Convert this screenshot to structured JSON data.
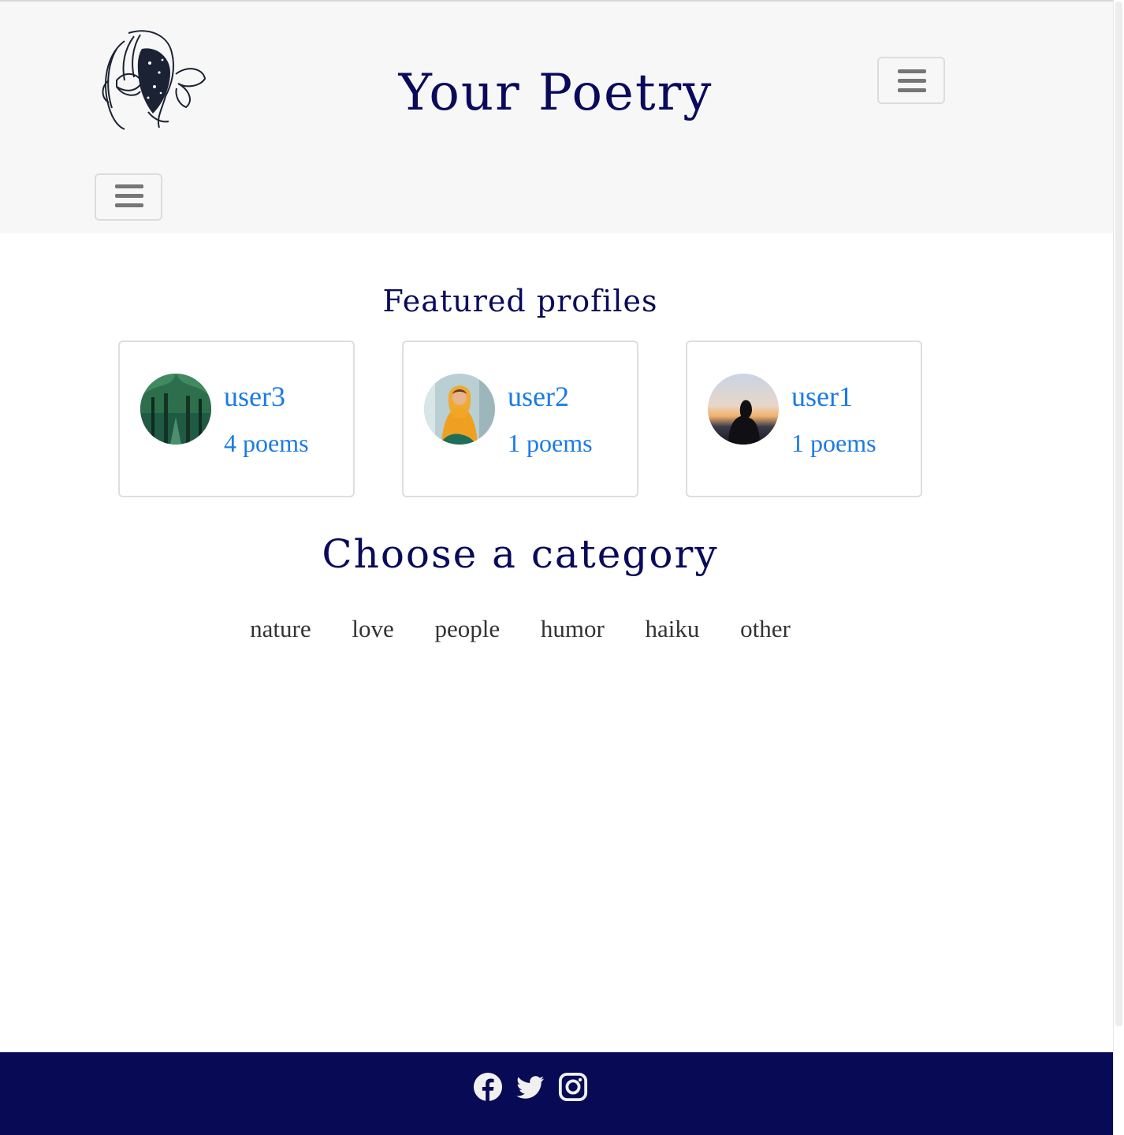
{
  "header": {
    "site_title": "Your Poetry",
    "logo_icon": "woman-butterfly-logo-icon",
    "menu_icon": "hamburger-menu-icon"
  },
  "featured": {
    "title": "Featured profiles",
    "profiles": [
      {
        "username": "user3",
        "poems": "4 poems",
        "avatar": "forest-trees-avatar"
      },
      {
        "username": "user2",
        "poems": "1 poems",
        "avatar": "girl-yellow-hoodie-avatar"
      },
      {
        "username": "user1",
        "poems": "1 poems",
        "avatar": "hooded-person-sunset-avatar"
      }
    ]
  },
  "categories": {
    "title": "Choose a category",
    "items": [
      "nature",
      "love",
      "people",
      "humor",
      "haiku",
      "other"
    ]
  },
  "footer": {
    "social_icons": [
      "facebook-icon",
      "twitter-icon",
      "instagram-icon"
    ]
  },
  "colors": {
    "title_navy": "#0a0a5c",
    "link_blue": "#1a7be6",
    "footer_navy": "#080a55",
    "header_bg": "#f7f7f7"
  }
}
